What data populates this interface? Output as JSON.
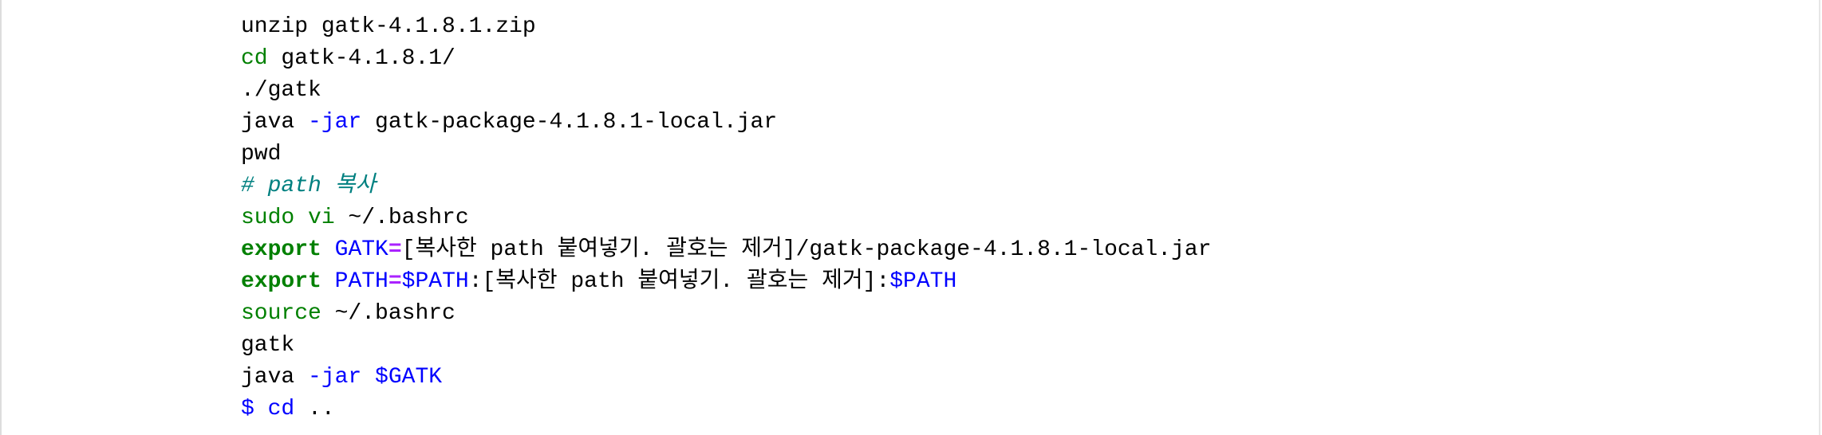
{
  "code_block": {
    "lines": [
      [
        {
          "t": "plain",
          "text": "unzip gatk-4.1.8.1.zip"
        }
      ],
      [
        {
          "t": "builtin",
          "text": "cd"
        },
        {
          "t": "plain",
          "text": " gatk-4.1.8.1/"
        }
      ],
      [
        {
          "t": "plain",
          "text": "./gatk"
        }
      ],
      [
        {
          "t": "plain",
          "text": "java "
        },
        {
          "t": "opt",
          "text": "-jar"
        },
        {
          "t": "plain",
          "text": " gatk-package-4.1.8.1-local.jar"
        }
      ],
      [
        {
          "t": "plain",
          "text": "pwd"
        }
      ],
      [
        {
          "t": "comment",
          "text": "# path 복사"
        }
      ],
      [
        {
          "t": "builtin",
          "text": "sudo vi"
        },
        {
          "t": "plain",
          "text": " ~/.bashrc"
        }
      ],
      [
        {
          "t": "kw",
          "text": "export"
        },
        {
          "t": "plain",
          "text": " "
        },
        {
          "t": "var",
          "text": "GATK"
        },
        {
          "t": "op",
          "text": "="
        },
        {
          "t": "plain",
          "text": "[복사한 path 붙여넣기. 괄호는 제거]/gatk-package-4.1.8.1-local.jar"
        }
      ],
      [
        {
          "t": "kw",
          "text": "export"
        },
        {
          "t": "plain",
          "text": " "
        },
        {
          "t": "var",
          "text": "PATH"
        },
        {
          "t": "op",
          "text": "="
        },
        {
          "t": "var",
          "text": "$PATH"
        },
        {
          "t": "plain",
          "text": ":[복사한 path 붙여넣기. 괄호는 제거]:"
        },
        {
          "t": "var",
          "text": "$PATH"
        }
      ],
      [
        {
          "t": "builtin",
          "text": "source"
        },
        {
          "t": "plain",
          "text": " ~/.bashrc"
        }
      ],
      [
        {
          "t": "plain",
          "text": "gatk"
        }
      ],
      [
        {
          "t": "plain",
          "text": "java "
        },
        {
          "t": "opt",
          "text": "-jar"
        },
        {
          "t": "plain",
          "text": " "
        },
        {
          "t": "var",
          "text": "$GATK"
        }
      ],
      [
        {
          "t": "prompt",
          "text": "$ cd"
        },
        {
          "t": "plain",
          "text": " .."
        }
      ]
    ]
  },
  "colors": {
    "builtin": "#008000",
    "keyword": "#008000",
    "variable": "#0000ff",
    "operator": "#aa22ff",
    "comment": "#008080",
    "text": "#000000",
    "background": "#ffffff"
  }
}
